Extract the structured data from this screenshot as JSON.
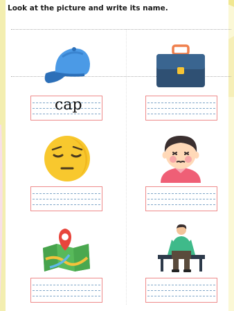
{
  "worksheet": {
    "instruction": "Look at the picture and write its name.",
    "items": [
      {
        "icon": "cap-icon",
        "answer": "cap"
      },
      {
        "icon": "briefcase-icon",
        "answer": ""
      },
      {
        "icon": "sad-face-icon",
        "answer": ""
      },
      {
        "icon": "boy-icon",
        "answer": ""
      },
      {
        "icon": "map-icon",
        "answer": ""
      },
      {
        "icon": "man-on-bench-icon",
        "answer": ""
      }
    ]
  },
  "colors": {
    "box_border": "#ee8a8a",
    "guide_line": "#7fa6c8",
    "background_accent": "#f6f2b4"
  }
}
